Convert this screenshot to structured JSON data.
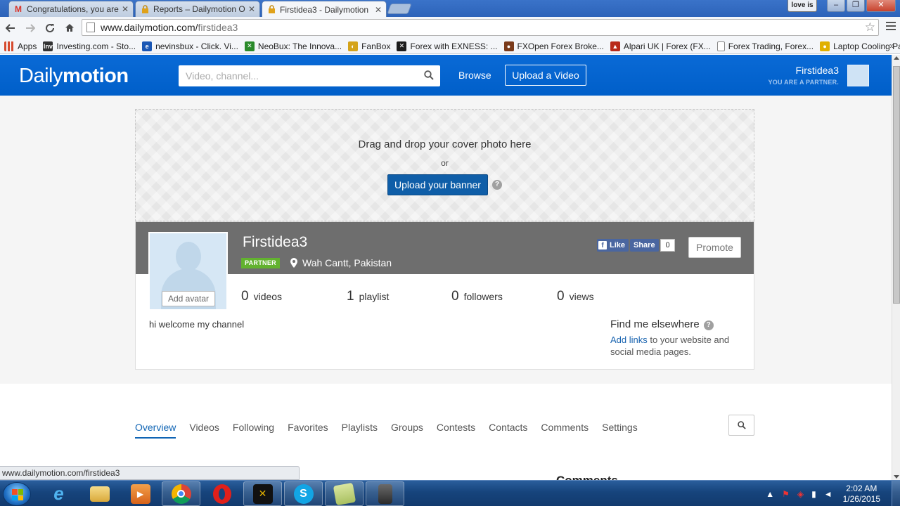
{
  "browser": {
    "tabs": [
      {
        "title": "Congratulations, you are n",
        "favicon": "gmail-icon",
        "favicon_color": "#d93025"
      },
      {
        "title": "Reports – Dailymotion Off",
        "favicon": "lock-icon",
        "favicon_color": "#e0a21a"
      },
      {
        "title": "Firstidea3 - Dailymotion",
        "favicon": "lock-icon",
        "favicon_color": "#e0a21a"
      }
    ],
    "close_glyph": "✕",
    "profile_label": "love is",
    "url_host": "www.dailymotion.com/",
    "url_path": "firstidea3",
    "bookmarks": [
      {
        "label": "Apps",
        "icon": "apps-icon",
        "color": "#d64b2f",
        "glyph": ""
      },
      {
        "label": "Investing.com - Sto...",
        "icon": "inv-icon",
        "color": "#333333",
        "glyph": "Inv"
      },
      {
        "label": "nevinsbux - Click. Vi...",
        "icon": "nevinsbux-icon",
        "color": "#1a57b5",
        "glyph": "e"
      },
      {
        "label": "NeoBux: The Innova...",
        "icon": "neobux-icon",
        "color": "#2a8a2a",
        "glyph": "✕"
      },
      {
        "label": "FanBox",
        "icon": "fanbox-icon",
        "color": "#d4a31a",
        "glyph": "◐"
      },
      {
        "label": "Forex with EXNESS: ...",
        "icon": "exness-icon",
        "color": "#1c1c1c",
        "glyph": "✕"
      },
      {
        "label": "FXOpen Forex Broke...",
        "icon": "fxopen-icon",
        "color": "#7a3a1a",
        "glyph": "●"
      },
      {
        "label": "Alpari UK | Forex (FX...",
        "icon": "alpari-icon",
        "color": "#b82a1a",
        "glyph": "▲"
      },
      {
        "label": "Forex Trading, Forex...",
        "icon": "page-icon",
        "color": "#ffffff",
        "glyph": ""
      },
      {
        "label": "Laptop Cooling Pad...",
        "icon": "coolingpad-icon",
        "color": "#e0b000",
        "glyph": "●"
      }
    ],
    "bookmarks_more": "»",
    "status_url": "www.dailymotion.com/firstidea3"
  },
  "dm": {
    "logo_light": "Daily",
    "logo_bold": "motion",
    "search_placeholder": "Video, channel...",
    "browse": "Browse",
    "upload": "Upload a Video",
    "user_name": "Firstidea3",
    "partner_note": "YOU ARE A PARTNER."
  },
  "cover": {
    "drop_text": "Drag and drop your cover photo here",
    "or_text": "or",
    "upload_banner": "Upload your banner",
    "help": "?"
  },
  "profile": {
    "name": "Firstidea3",
    "badge": "PARTNER",
    "location": "Wah Cantt, Pakistan",
    "add_avatar": "Add avatar",
    "fb_like": "Like",
    "fb_share": "Share",
    "fb_count": "0",
    "promote": "Promote",
    "stats": [
      {
        "num": "0",
        "label": "videos"
      },
      {
        "num": "1",
        "label": "playlist"
      },
      {
        "num": "0",
        "label": "followers"
      },
      {
        "num": "0",
        "label": "views"
      }
    ],
    "bio": "hi welcome my channel",
    "elsewhere_title": "Find me elsewhere",
    "elsewhere_link": "Add links",
    "elsewhere_rest": " to your website and social media pages."
  },
  "tabs": [
    "Overview",
    "Videos",
    "Following",
    "Favorites",
    "Playlists",
    "Groups",
    "Contests",
    "Contacts",
    "Comments",
    "Settings"
  ],
  "active_tab": "Overview",
  "comments_heading": "Comments",
  "taskbar": {
    "time": "2:02 AM",
    "date": "1/26/2015"
  },
  "colors": {
    "dm_blue": "#0066dc",
    "partner_green": "#62b22f",
    "facebook_blue": "#4a66a0",
    "link_blue": "#1a64b0"
  }
}
